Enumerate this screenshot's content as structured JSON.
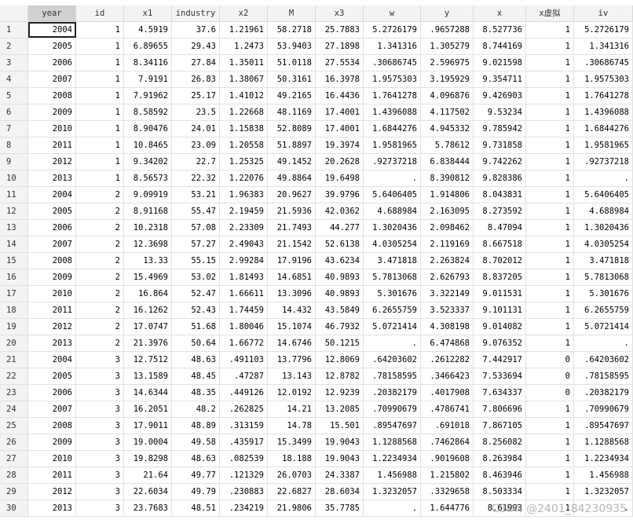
{
  "columns": [
    "",
    "year",
    "id",
    "x1",
    "industry",
    "x2",
    "M",
    "x3",
    "w",
    "y",
    "x",
    "x虚拟",
    "iv"
  ],
  "rows": [
    [
      "1",
      "2004",
      "1",
      "4.5919",
      "37.6",
      "1.21961",
      "58.2718",
      "25.7883",
      "5.2726179",
      ".9657288",
      "8.527736",
      "1",
      "5.2726179"
    ],
    [
      "2",
      "2005",
      "1",
      "6.89655",
      "29.43",
      "1.2473",
      "53.9403",
      "27.1898",
      "1.341316",
      "1.305279",
      "8.744169",
      "1",
      "1.341316"
    ],
    [
      "3",
      "2006",
      "1",
      "8.34116",
      "27.84",
      "1.35011",
      "51.0118",
      "27.5534",
      ".30686745",
      "2.596975",
      "9.021598",
      "1",
      ".30686745"
    ],
    [
      "4",
      "2007",
      "1",
      "7.9191",
      "26.83",
      "1.38067",
      "50.3161",
      "16.3978",
      "1.9575303",
      "3.195929",
      "9.354711",
      "1",
      "1.9575303"
    ],
    [
      "5",
      "2008",
      "1",
      "7.91962",
      "25.17",
      "1.41012",
      "49.2165",
      "16.4436",
      "1.7641278",
      "4.096876",
      "9.426903",
      "1",
      "1.7641278"
    ],
    [
      "6",
      "2009",
      "1",
      "8.58592",
      "23.5",
      "1.22668",
      "48.1169",
      "17.4001",
      "1.4396088",
      "4.117502",
      "9.53234",
      "1",
      "1.4396088"
    ],
    [
      "7",
      "2010",
      "1",
      "8.90476",
      "24.01",
      "1.15838",
      "52.8089",
      "17.4001",
      "1.6844276",
      "4.945332",
      "9.785942",
      "1",
      "1.6844276"
    ],
    [
      "8",
      "2011",
      "1",
      "10.8465",
      "23.09",
      "1.20558",
      "51.8897",
      "19.3974",
      "1.9581965",
      "5.78612",
      "9.731858",
      "1",
      "1.9581965"
    ],
    [
      "9",
      "2012",
      "1",
      "9.34202",
      "22.7",
      "1.25325",
      "49.1452",
      "20.2628",
      ".92737218",
      "6.838444",
      "9.742262",
      "1",
      ".92737218"
    ],
    [
      "10",
      "2013",
      "1",
      "8.56573",
      "22.32",
      "1.22076",
      "49.8864",
      "19.6498",
      ".",
      "8.390812",
      "9.828386",
      "1",
      "."
    ],
    [
      "11",
      "2004",
      "2",
      "9.09919",
      "53.21",
      "1.96383",
      "20.9627",
      "39.9796",
      "5.6406405",
      "1.914806",
      "8.043831",
      "1",
      "5.6406405"
    ],
    [
      "12",
      "2005",
      "2",
      "8.91168",
      "55.47",
      "2.19459",
      "21.5936",
      "42.0362",
      "4.688984",
      "2.163095",
      "8.273592",
      "1",
      "4.688984"
    ],
    [
      "13",
      "2006",
      "2",
      "10.2318",
      "57.08",
      "2.23309",
      "21.7493",
      "44.277",
      "1.3020436",
      "2.098462",
      "8.47094",
      "1",
      "1.3020436"
    ],
    [
      "14",
      "2007",
      "2",
      "12.3698",
      "57.27",
      "2.49043",
      "21.1542",
      "52.6138",
      "4.0305254",
      "2.119169",
      "8.667518",
      "1",
      "4.0305254"
    ],
    [
      "15",
      "2008",
      "2",
      "13.33",
      "55.15",
      "2.99284",
      "17.9196",
      "43.6234",
      "3.471818",
      "2.263824",
      "8.702012",
      "1",
      "3.471818"
    ],
    [
      "16",
      "2009",
      "2",
      "15.4969",
      "53.02",
      "1.81493",
      "14.6851",
      "40.9893",
      "5.7813068",
      "2.626793",
      "8.837205",
      "1",
      "5.7813068"
    ],
    [
      "17",
      "2010",
      "2",
      "16.864",
      "52.47",
      "1.66611",
      "13.3096",
      "40.9893",
      "5.301676",
      "3.322149",
      "9.011531",
      "1",
      "5.301676"
    ],
    [
      "18",
      "2011",
      "2",
      "16.1262",
      "52.43",
      "1.74459",
      "14.432",
      "43.5849",
      "6.2655759",
      "3.523337",
      "9.101131",
      "1",
      "6.2655759"
    ],
    [
      "19",
      "2012",
      "2",
      "17.0747",
      "51.68",
      "1.80046",
      "15.1074",
      "46.7932",
      "5.0721414",
      "4.308198",
      "9.014082",
      "1",
      "5.0721414"
    ],
    [
      "20",
      "2013",
      "2",
      "21.3976",
      "50.64",
      "1.66772",
      "14.6746",
      "50.1215",
      ".",
      "6.474868",
      "9.076352",
      "1",
      "."
    ],
    [
      "21",
      "2004",
      "3",
      "12.7512",
      "48.63",
      ".491103",
      "13.7796",
      "12.8069",
      ".64203602",
      ".2612282",
      "7.442917",
      "0",
      ".64203602"
    ],
    [
      "22",
      "2005",
      "3",
      "13.1589",
      "48.45",
      ".47287",
      "13.143",
      "12.8782",
      ".78158595",
      ".3466423",
      "7.533694",
      "0",
      ".78158595"
    ],
    [
      "23",
      "2006",
      "3",
      "14.6344",
      "48.35",
      ".449126",
      "12.0192",
      "12.9239",
      ".20382179",
      ".4017908",
      "7.634337",
      "0",
      ".20382179"
    ],
    [
      "24",
      "2007",
      "3",
      "16.2051",
      "48.2",
      ".262825",
      "14.21",
      "13.2085",
      ".70990679",
      ".4786741",
      "7.806696",
      "1",
      ".70990679"
    ],
    [
      "25",
      "2008",
      "3",
      "17.9011",
      "48.89",
      ".313159",
      "14.78",
      "15.501",
      ".89547697",
      ".691018",
      "7.867105",
      "1",
      ".89547697"
    ],
    [
      "26",
      "2009",
      "3",
      "19.0004",
      "49.58",
      ".435917",
      "15.3499",
      "19.9043",
      "1.1288568",
      ".7462864",
      "8.256082",
      "1",
      "1.1288568"
    ],
    [
      "27",
      "2010",
      "3",
      "19.8298",
      "48.63",
      ".082539",
      "18.188",
      "19.9043",
      "1.2234934",
      ".9019608",
      "8.263984",
      "1",
      "1.2234934"
    ],
    [
      "28",
      "2011",
      "3",
      "21.64",
      "49.77",
      ".121329",
      "26.0703",
      "24.3387",
      "1.456988",
      "1.215802",
      "8.463946",
      "1",
      "1.456988"
    ],
    [
      "29",
      "2012",
      "3",
      "22.6034",
      "49.79",
      ".230883",
      "22.6827",
      "28.6034",
      "1.3232057",
      ".3329658",
      "8.503334",
      "1",
      "1.3232057"
    ],
    [
      "30",
      "2013",
      "3",
      "23.7683",
      "48.51",
      ".234219",
      "21.9806",
      "35.7785",
      ".",
      "1.644776",
      "8.61993",
      "1",
      "."
    ]
  ],
  "watermark": "CSDN @2401_84230935"
}
